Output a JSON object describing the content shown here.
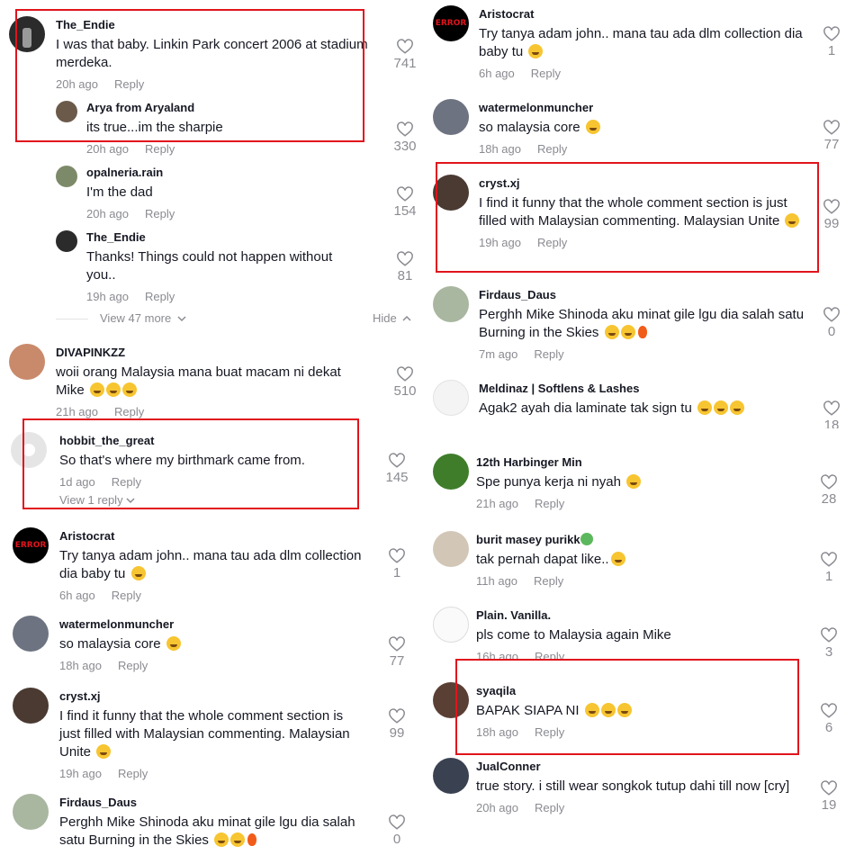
{
  "left": {
    "comments": [
      {
        "user": "The_Endie",
        "text": "I was that baby. Linkin Park concert 2006 at stadium merdeka.",
        "time": "20h ago",
        "reply": "Reply",
        "likes": "741"
      },
      {
        "user": "Arya from Aryaland",
        "text": "its true...im the sharpie",
        "time": "20h ago",
        "reply": "Reply",
        "likes": "330"
      },
      {
        "user": "opalneria.rain",
        "text": "I'm the dad",
        "time": "20h ago",
        "reply": "Reply",
        "likes": "154"
      },
      {
        "user": "The_Endie",
        "text": "Thanks! Things could not happen without you..",
        "time": "19h ago",
        "reply": "Reply",
        "likes": "81"
      },
      {
        "user": "DIVAPINKZZ",
        "text": "woii orang Malaysia mana buat macam ni dekat Mike",
        "time": "21h ago",
        "reply": "Reply",
        "likes": "510"
      },
      {
        "user": "hobbit_the_great",
        "text": "So that's where my birthmark came from.",
        "time": "1d ago",
        "reply": "Reply",
        "likes": "145"
      },
      {
        "user": "Aristocrat",
        "text": "Try tanya adam john.. mana tau ada dlm collection dia baby tu",
        "time": "6h ago",
        "reply": "Reply",
        "likes": "1"
      },
      {
        "user": "watermelonmuncher",
        "text": "so malaysia core",
        "time": "18h ago",
        "reply": "Reply",
        "likes": "77"
      },
      {
        "user": "cryst.xj",
        "text": "I find it funny that the whole comment section is just filled with Malaysian commenting. Malaysian Unite",
        "time": "19h ago",
        "reply": "Reply",
        "likes": "99"
      },
      {
        "user": "Firdaus_Daus",
        "text": "Perghh Mike Shinoda aku minat gile lgu dia salah satu Burning in the Skies",
        "time": "",
        "reply": "",
        "likes": "0"
      }
    ],
    "view_more": "View 47 more",
    "hide": "Hide",
    "view_reply": "View 1 reply"
  },
  "right": {
    "comments": [
      {
        "user": "Aristocrat",
        "text": "Try tanya adam john.. mana tau ada dlm collection dia baby tu",
        "time": "6h ago",
        "reply": "Reply",
        "likes": "1"
      },
      {
        "user": "watermelonmuncher",
        "text": "so malaysia core",
        "time": "18h ago",
        "reply": "Reply",
        "likes": "77"
      },
      {
        "user": "cryst.xj",
        "text": "I find it funny that the whole comment section is just filled with Malaysian commenting. Malaysian Unite",
        "time": "19h ago",
        "reply": "Reply",
        "likes": "99"
      },
      {
        "user": "Firdaus_Daus",
        "text": "Perghh Mike Shinoda aku minat gile lgu dia salah satu Burning in the Skies",
        "time": "7m ago",
        "reply": "Reply",
        "likes": "0"
      },
      {
        "user": "Meldinaz | Softlens & Lashes",
        "text": "Agak2 ayah dia laminate tak sign tu",
        "time": "",
        "reply": "",
        "likes": "18"
      },
      {
        "user": "12th Harbinger Min",
        "text": "Spe punya kerja ni nyah",
        "time": "21h ago",
        "reply": "Reply",
        "likes": "28"
      },
      {
        "user": "burit masey purikk",
        "text": "tak pernah dapat like..",
        "time": "11h ago",
        "reply": "Reply",
        "likes": "1"
      },
      {
        "user": "Plain. Vanilla.",
        "text": "pls come to Malaysia again Mike",
        "time": "16h ago",
        "reply": "Reply",
        "likes": "3"
      },
      {
        "user": "syaqila",
        "text": "BAPAK SIAPA NI",
        "time": "18h ago",
        "reply": "Reply",
        "likes": "6"
      },
      {
        "user": "JualConner",
        "text": "true story. i still wear songkok tutup dahi till now [cry]",
        "time": "20h ago",
        "reply": "Reply",
        "likes": "19"
      }
    ]
  },
  "colors": {
    "highlight_box": "#e1141c",
    "muted_text": "#8a8b91",
    "primary_text": "#161823"
  },
  "icons": {
    "like": "heart-outline-icon",
    "chevron": "chevron-down-icon"
  }
}
